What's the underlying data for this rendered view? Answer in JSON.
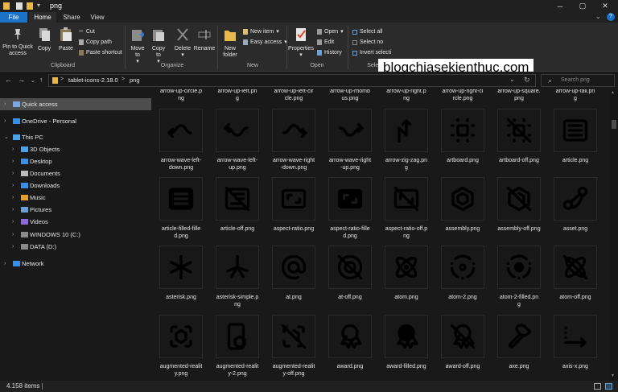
{
  "window": {
    "title": "png"
  },
  "tabs": [
    {
      "label": "File"
    },
    {
      "label": "Home"
    },
    {
      "label": "Share"
    },
    {
      "label": "View"
    }
  ],
  "ribbon": {
    "clipboard": {
      "pin": "Pin to Quick access",
      "copy": "Copy",
      "paste": "Paste",
      "cut": "Cut",
      "copy_path": "Copy path",
      "paste_shortcut": "Paste shortcut",
      "group": "Clipboard"
    },
    "organize": {
      "move_to": "Move to",
      "copy_to": "Copy to",
      "delete": "Delete",
      "rename": "Rename",
      "group": "Organize"
    },
    "new": {
      "new_folder": "New folder",
      "new_item": "New item",
      "easy_access": "Easy access",
      "group": "New"
    },
    "open": {
      "properties": "Properties",
      "open": "Open",
      "edit": "Edit",
      "history": "History",
      "group": "Open"
    },
    "select": {
      "select_all": "Select all",
      "select_none": "Select no",
      "invert": "Invert selecti",
      "group": "Select"
    }
  },
  "watermark": "blogchiasekienthuc.com",
  "address": {
    "parts": [
      "tablet-icons-2.18.0",
      "png"
    ],
    "sep": ">",
    "search_placeholder": "Search png"
  },
  "nav_pane": [
    {
      "label": "Quick access",
      "icon": "star-icon"
    },
    {
      "label": "OneDrive - Personal",
      "icon": "cloud-icon"
    },
    {
      "label": "This PC",
      "icon": "computer-icon"
    },
    {
      "label": "3D Objects",
      "icon": "folder-icon"
    },
    {
      "label": "Desktop",
      "icon": "folder-icon"
    },
    {
      "label": "Documents",
      "icon": "folder-icon"
    },
    {
      "label": "Downloads",
      "icon": "folder-icon"
    },
    {
      "label": "Music",
      "icon": "folder-icon"
    },
    {
      "label": "Pictures",
      "icon": "folder-icon"
    },
    {
      "label": "Videos",
      "icon": "folder-icon"
    },
    {
      "label": "WINDOWS 10 (C:)",
      "icon": "drive-icon"
    },
    {
      "label": "DATA (D:)",
      "icon": "drive-icon"
    },
    {
      "label": "Network",
      "icon": "network-icon"
    }
  ],
  "top_row": [
    {
      "l1": "arrow-up-circle.p",
      "l2": "ng"
    },
    {
      "l1": "arrow-up-left.pn",
      "l2": "g"
    },
    {
      "l1": "arrow-up-left-cir",
      "l2": "cle.png"
    },
    {
      "l1": "arrow-up-rhomb",
      "l2": "us.png"
    },
    {
      "l1": "arrow-up-right.p",
      "l2": "ng"
    },
    {
      "l1": "arrow-up-right-ci",
      "l2": "rcle.png"
    },
    {
      "l1": "arrow-up-square.",
      "l2": "png"
    },
    {
      "l1": "arrow-up-tail.pn",
      "l2": "g"
    }
  ],
  "files": [
    {
      "l1": "arrow-wave-left-",
      "l2": "down.png",
      "icon": "wave-left-down"
    },
    {
      "l1": "arrow-wave-left-",
      "l2": "up.png",
      "icon": "wave-left-up"
    },
    {
      "l1": "arrow-wave-right",
      "l2": "-down.png",
      "icon": "wave-right-down"
    },
    {
      "l1": "arrow-wave-right",
      "l2": "-up.png",
      "icon": "wave-right-up"
    },
    {
      "l1": "arrow-zig-zag.pn",
      "l2": "g",
      "icon": "zig-zag"
    },
    {
      "l1": "artboard.png",
      "l2": "",
      "icon": "artboard"
    },
    {
      "l1": "artboard-off.png",
      "l2": "",
      "icon": "artboard-off"
    },
    {
      "l1": "article.png",
      "l2": "",
      "icon": "article"
    },
    {
      "l1": "article-filled-fille",
      "l2": "d.png",
      "icon": "article-filled"
    },
    {
      "l1": "article-off.png",
      "l2": "",
      "icon": "article-off"
    },
    {
      "l1": "aspect-ratio.png",
      "l2": "",
      "icon": "aspect-ratio"
    },
    {
      "l1": "aspect-ratio-fille",
      "l2": "d.png",
      "icon": "aspect-ratio-filled"
    },
    {
      "l1": "aspect-ratio-off.p",
      "l2": "ng",
      "icon": "aspect-ratio-off"
    },
    {
      "l1": "assembly.png",
      "l2": "",
      "icon": "assembly"
    },
    {
      "l1": "assembly-off.png",
      "l2": "",
      "icon": "assembly-off"
    },
    {
      "l1": "asset.png",
      "l2": "",
      "icon": "asset"
    },
    {
      "l1": "asterisk.png",
      "l2": "",
      "icon": "asterisk"
    },
    {
      "l1": "asterisk-simple.p",
      "l2": "ng",
      "icon": "asterisk-simple"
    },
    {
      "l1": "at.png",
      "l2": "",
      "icon": "at"
    },
    {
      "l1": "at-off.png",
      "l2": "",
      "icon": "at-off"
    },
    {
      "l1": "atom.png",
      "l2": "",
      "icon": "atom"
    },
    {
      "l1": "atom-2.png",
      "l2": "",
      "icon": "atom-2"
    },
    {
      "l1": "atom-2-filled.pn",
      "l2": "g",
      "icon": "atom-2-filled"
    },
    {
      "l1": "atom-off.png",
      "l2": "",
      "icon": "atom-off"
    },
    {
      "l1": "augmented-realit",
      "l2": "y.png",
      "icon": "ar"
    },
    {
      "l1": "augmented-realit",
      "l2": "y-2.png",
      "icon": "ar-2"
    },
    {
      "l1": "augmented-realit",
      "l2": "y-off.png",
      "icon": "ar-off"
    },
    {
      "l1": "award.png",
      "l2": "",
      "icon": "award"
    },
    {
      "l1": "award-filled.png",
      "l2": "",
      "icon": "award-filled"
    },
    {
      "l1": "award-off.png",
      "l2": "",
      "icon": "award-off"
    },
    {
      "l1": "axe.png",
      "l2": "",
      "icon": "axe"
    },
    {
      "l1": "axis-x.png",
      "l2": "",
      "icon": "axis-x"
    }
  ],
  "status": {
    "count": "4.158 items"
  }
}
